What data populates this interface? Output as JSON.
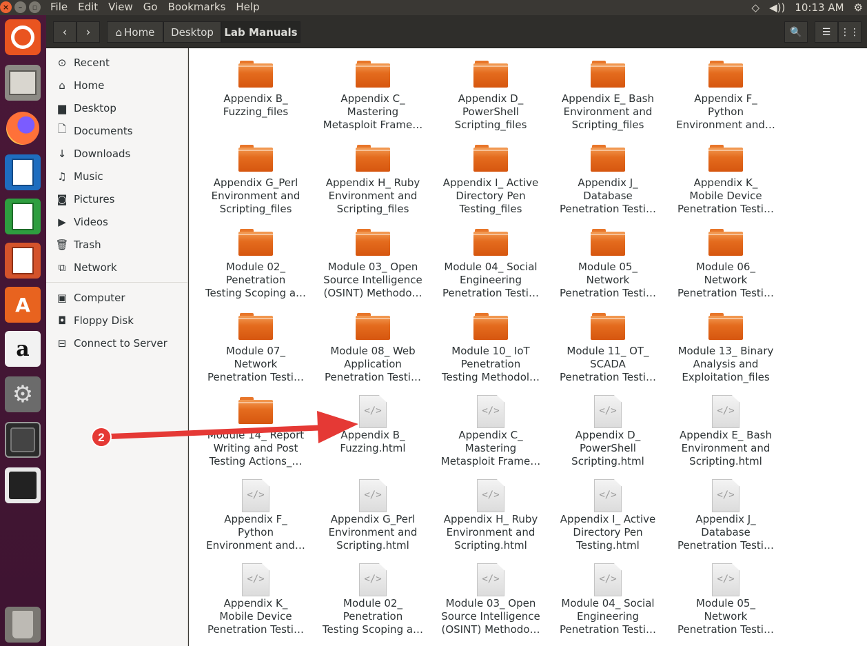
{
  "topbar": {
    "menu": [
      "File",
      "Edit",
      "View",
      "Go",
      "Bookmarks",
      "Help"
    ],
    "time": "10:13 AM"
  },
  "headerbar": {
    "crumbs": [
      "Home",
      "Desktop",
      "Lab Manuals"
    ]
  },
  "sidebar": {
    "items": [
      {
        "label": "Recent",
        "icon": "clock-icon",
        "glyph": "⊙"
      },
      {
        "label": "Home",
        "icon": "home-icon",
        "glyph": "⌂"
      },
      {
        "label": "Desktop",
        "icon": "folder-icon",
        "glyph": "▆"
      },
      {
        "label": "Documents",
        "icon": "document-icon",
        "glyph": "🗋"
      },
      {
        "label": "Downloads",
        "icon": "download-icon",
        "glyph": "↓"
      },
      {
        "label": "Music",
        "icon": "music-icon",
        "glyph": "♫"
      },
      {
        "label": "Pictures",
        "icon": "camera-icon",
        "glyph": "◙"
      },
      {
        "label": "Videos",
        "icon": "video-icon",
        "glyph": "▶"
      },
      {
        "label": "Trash",
        "icon": "trash-icon",
        "glyph": "🗑"
      },
      {
        "label": "Network",
        "icon": "network-icon",
        "glyph": "⧉"
      }
    ],
    "devices": [
      {
        "label": "Computer",
        "icon": "computer-icon",
        "glyph": "▣"
      },
      {
        "label": "Floppy Disk",
        "icon": "floppy-icon",
        "glyph": "◘"
      },
      {
        "label": "Connect to Server",
        "icon": "server-icon",
        "glyph": "⊟"
      }
    ]
  },
  "files": [
    {
      "name": "Appendix B_\nFuzzing_files",
      "type": "folder"
    },
    {
      "name": "Appendix C_\nMastering\nMetasploit Frame…",
      "type": "folder"
    },
    {
      "name": "Appendix D_\nPowerShell\nScripting_files",
      "type": "folder"
    },
    {
      "name": "Appendix E_ Bash\nEnvironment and\nScripting_files",
      "type": "folder"
    },
    {
      "name": "Appendix F_\nPython\nEnvironment and…",
      "type": "folder"
    },
    {
      "name": "Appendix G_Perl\nEnvironment and\nScripting_files",
      "type": "folder"
    },
    {
      "name": "Appendix H_ Ruby\nEnvironment and\nScripting_files",
      "type": "folder"
    },
    {
      "name": "Appendix I_ Active\nDirectory Pen\nTesting_files",
      "type": "folder"
    },
    {
      "name": "Appendix J_\nDatabase\nPenetration Testi…",
      "type": "folder"
    },
    {
      "name": "Appendix K_\nMobile Device\nPenetration Testi…",
      "type": "folder"
    },
    {
      "name": "Module 02_\nPenetration\nTesting Scoping a…",
      "type": "folder"
    },
    {
      "name": "Module 03_ Open\nSource Intelligence\n(OSINT) Methodo…",
      "type": "folder"
    },
    {
      "name": "Module 04_ Social\nEngineering\nPenetration Testi…",
      "type": "folder"
    },
    {
      "name": "Module 05_\nNetwork\nPenetration Testi…",
      "type": "folder"
    },
    {
      "name": "Module 06_\nNetwork\nPenetration Testi…",
      "type": "folder"
    },
    {
      "name": "Module 07_\nNetwork\nPenetration Testi…",
      "type": "folder"
    },
    {
      "name": "Module 08_ Web\nApplication\nPenetration Testi…",
      "type": "folder"
    },
    {
      "name": "Module 10_ IoT\nPenetration\nTesting Methodol…",
      "type": "folder"
    },
    {
      "name": "Module 11_ OT_\nSCADA\nPenetration Testi…",
      "type": "folder"
    },
    {
      "name": "Module 13_ Binary\nAnalysis and\nExploitation_files",
      "type": "folder"
    },
    {
      "name": "Module 14_ Report\nWriting and Post\nTesting Actions_…",
      "type": "folder"
    },
    {
      "name": "Appendix B_\nFuzzing.html",
      "type": "html"
    },
    {
      "name": "Appendix C_\nMastering\nMetasploit Frame…",
      "type": "html"
    },
    {
      "name": "Appendix D_\nPowerShell\nScripting.html",
      "type": "html"
    },
    {
      "name": "Appendix E_ Bash\nEnvironment and\nScripting.html",
      "type": "html"
    },
    {
      "name": "Appendix F_\nPython\nEnvironment and…",
      "type": "html"
    },
    {
      "name": "Appendix G_Perl\nEnvironment and\nScripting.html",
      "type": "html"
    },
    {
      "name": "Appendix H_ Ruby\nEnvironment and\nScripting.html",
      "type": "html"
    },
    {
      "name": "Appendix I_ Active\nDirectory Pen\nTesting.html",
      "type": "html"
    },
    {
      "name": "Appendix J_\nDatabase\nPenetration Testi…",
      "type": "html"
    },
    {
      "name": "Appendix K_\nMobile Device\nPenetration Testi…",
      "type": "html"
    },
    {
      "name": "Module 02_\nPenetration\nTesting Scoping a…",
      "type": "html"
    },
    {
      "name": "Module 03_ Open\nSource Intelligence\n(OSINT) Methodo…",
      "type": "html"
    },
    {
      "name": "Module 04_ Social\nEngineering\nPenetration Testi…",
      "type": "html"
    },
    {
      "name": "Module 05_\nNetwork\nPenetration Testi…",
      "type": "html"
    }
  ],
  "annotation": {
    "number": "2",
    "color": "#e53935"
  }
}
